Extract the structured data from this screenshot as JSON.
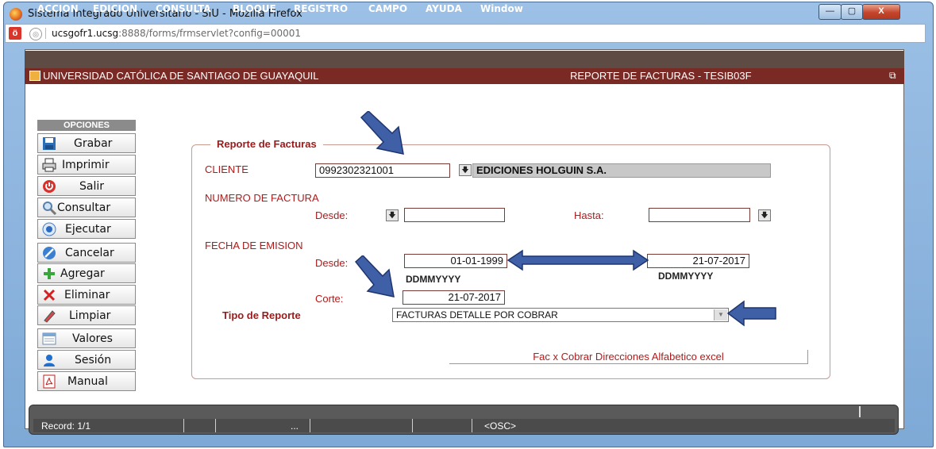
{
  "window": {
    "title": "Sistema Integrado Universitario - SIU - Mozilla Firefox",
    "min": "—",
    "max": "▢",
    "close": "X"
  },
  "urlbar": {
    "host": "ucsgofr1.ucsg",
    "rest": ":8888/forms/frmservlet?config=00001"
  },
  "menu": [
    "ACCION",
    "EDICION",
    "CONSULTA",
    "BLOQUE",
    "REGISTRO",
    "CAMPO",
    "AYUDA",
    "Window"
  ],
  "header": {
    "left": "UNIVERSIDAD CATÓLICA DE SANTIAGO DE GUAYAQUIL",
    "right": "REPORTE DE FACTURAS - TESIB03F",
    "restore": "⧉"
  },
  "options": {
    "title": "OPCIONES",
    "buttons": [
      "Grabar",
      "Imprimir",
      "Salir",
      "Consultar",
      "Ejecutar",
      "Cancelar",
      "Agregar",
      "Eliminar",
      "Limpiar",
      "Valores",
      "Sesión",
      "Manual"
    ]
  },
  "report": {
    "group_title": "Reporte de Facturas",
    "cliente_label": "CLIENTE",
    "cliente_value": "0992302321001",
    "cliente_name": "EDICIONES HOLGUIN S.A.",
    "numero_label": "NUMERO DE FACTURA",
    "desde_label": "Desde:",
    "hasta_label": "Hasta:",
    "fecha_label": "FECHA DE EMISION",
    "fecha_desde_label": "Desde:",
    "fecha_desde_value": "01-01-1999",
    "fecha_hasta_value": "21-07-2017",
    "format_hint": "DDMMYYYY",
    "corte_label": "Corte:",
    "corte_value": "21-07-2017",
    "tipo_label": "Tipo de Reporte",
    "tipo_value": "FACTURAS DETALLE POR COBRAR",
    "action_label": "Fac x Cobrar Direcciones Alfabetico  excel"
  },
  "status": {
    "record": "Record: 1/1",
    "dots": "...",
    "osc": "<OSC>"
  },
  "colors": {
    "arrow": "#3f5fa6",
    "header": "#7a2a25",
    "menubar": "#5e4c44"
  }
}
